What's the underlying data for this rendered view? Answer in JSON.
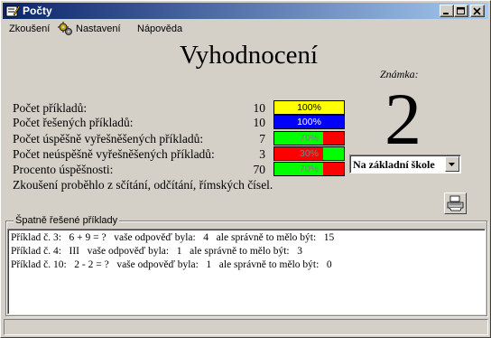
{
  "window": {
    "title": "Počty",
    "icon": "pencil-icon"
  },
  "menu": {
    "items": [
      "Zkoušení",
      "Nastavení",
      "Nápověda"
    ],
    "settings_icon": "gears-icon"
  },
  "main": {
    "heading": "Vyhodnocení",
    "grade_label": "Známka:",
    "grade_value": "2",
    "stats": [
      {
        "label": "Počet příkladů:",
        "value": "10",
        "bar_text": "100%",
        "fill": 1.0,
        "fill_color": "#ffff00",
        "text_color": "#000000"
      },
      {
        "label": "Počet řešených příkladů:",
        "value": "10",
        "bar_text": "100%",
        "fill": 1.0,
        "fill_color": "#0000ff",
        "text_color": "#ffffff"
      },
      {
        "label": "Počet úspěšně vyřešněšených příkladů:",
        "value": "7",
        "bar_text": "70%",
        "fill": 0.7,
        "fill_color": "#00ff00",
        "text_color": "#808080"
      },
      {
        "label": "Počet neúspěšně vyřešněšených příkladů:",
        "value": "3",
        "bar_text": "30%",
        "fill": 0.3,
        "fill_color": "#00ff00",
        "text_color": "#808080",
        "fill_side": "right"
      },
      {
        "label": "Procento úspěšnosti:",
        "value": "70",
        "bar_text": "70%",
        "fill": 0.7,
        "fill_color": "#00ff00",
        "text_color": "#808080"
      }
    ],
    "summary": "Zkoušení proběhlo z sčítání, odčítání, římských čísel.",
    "level_select": {
      "value": "Na základní škole"
    },
    "print_icon": "printer-icon"
  },
  "wrong_answers": {
    "title": "Špatně řešené příklady",
    "rows": [
      "Příklad č. 3:   6 + 9 = ?   vaše odpověď byla:   4   ale správně to mělo být:   15",
      "Příklad č. 4:   III   vaše odpověď byla:   1   ale správně to mělo být:   3",
      "Příklad č. 10:   2 - 2 = ?   vaše odpověď byla:   1   ale správně to mělo být:   0"
    ]
  },
  "colors": {
    "titlebar_start": "#0a246a",
    "titlebar_end": "#a6caf0",
    "bar_background": "#ff0000"
  }
}
